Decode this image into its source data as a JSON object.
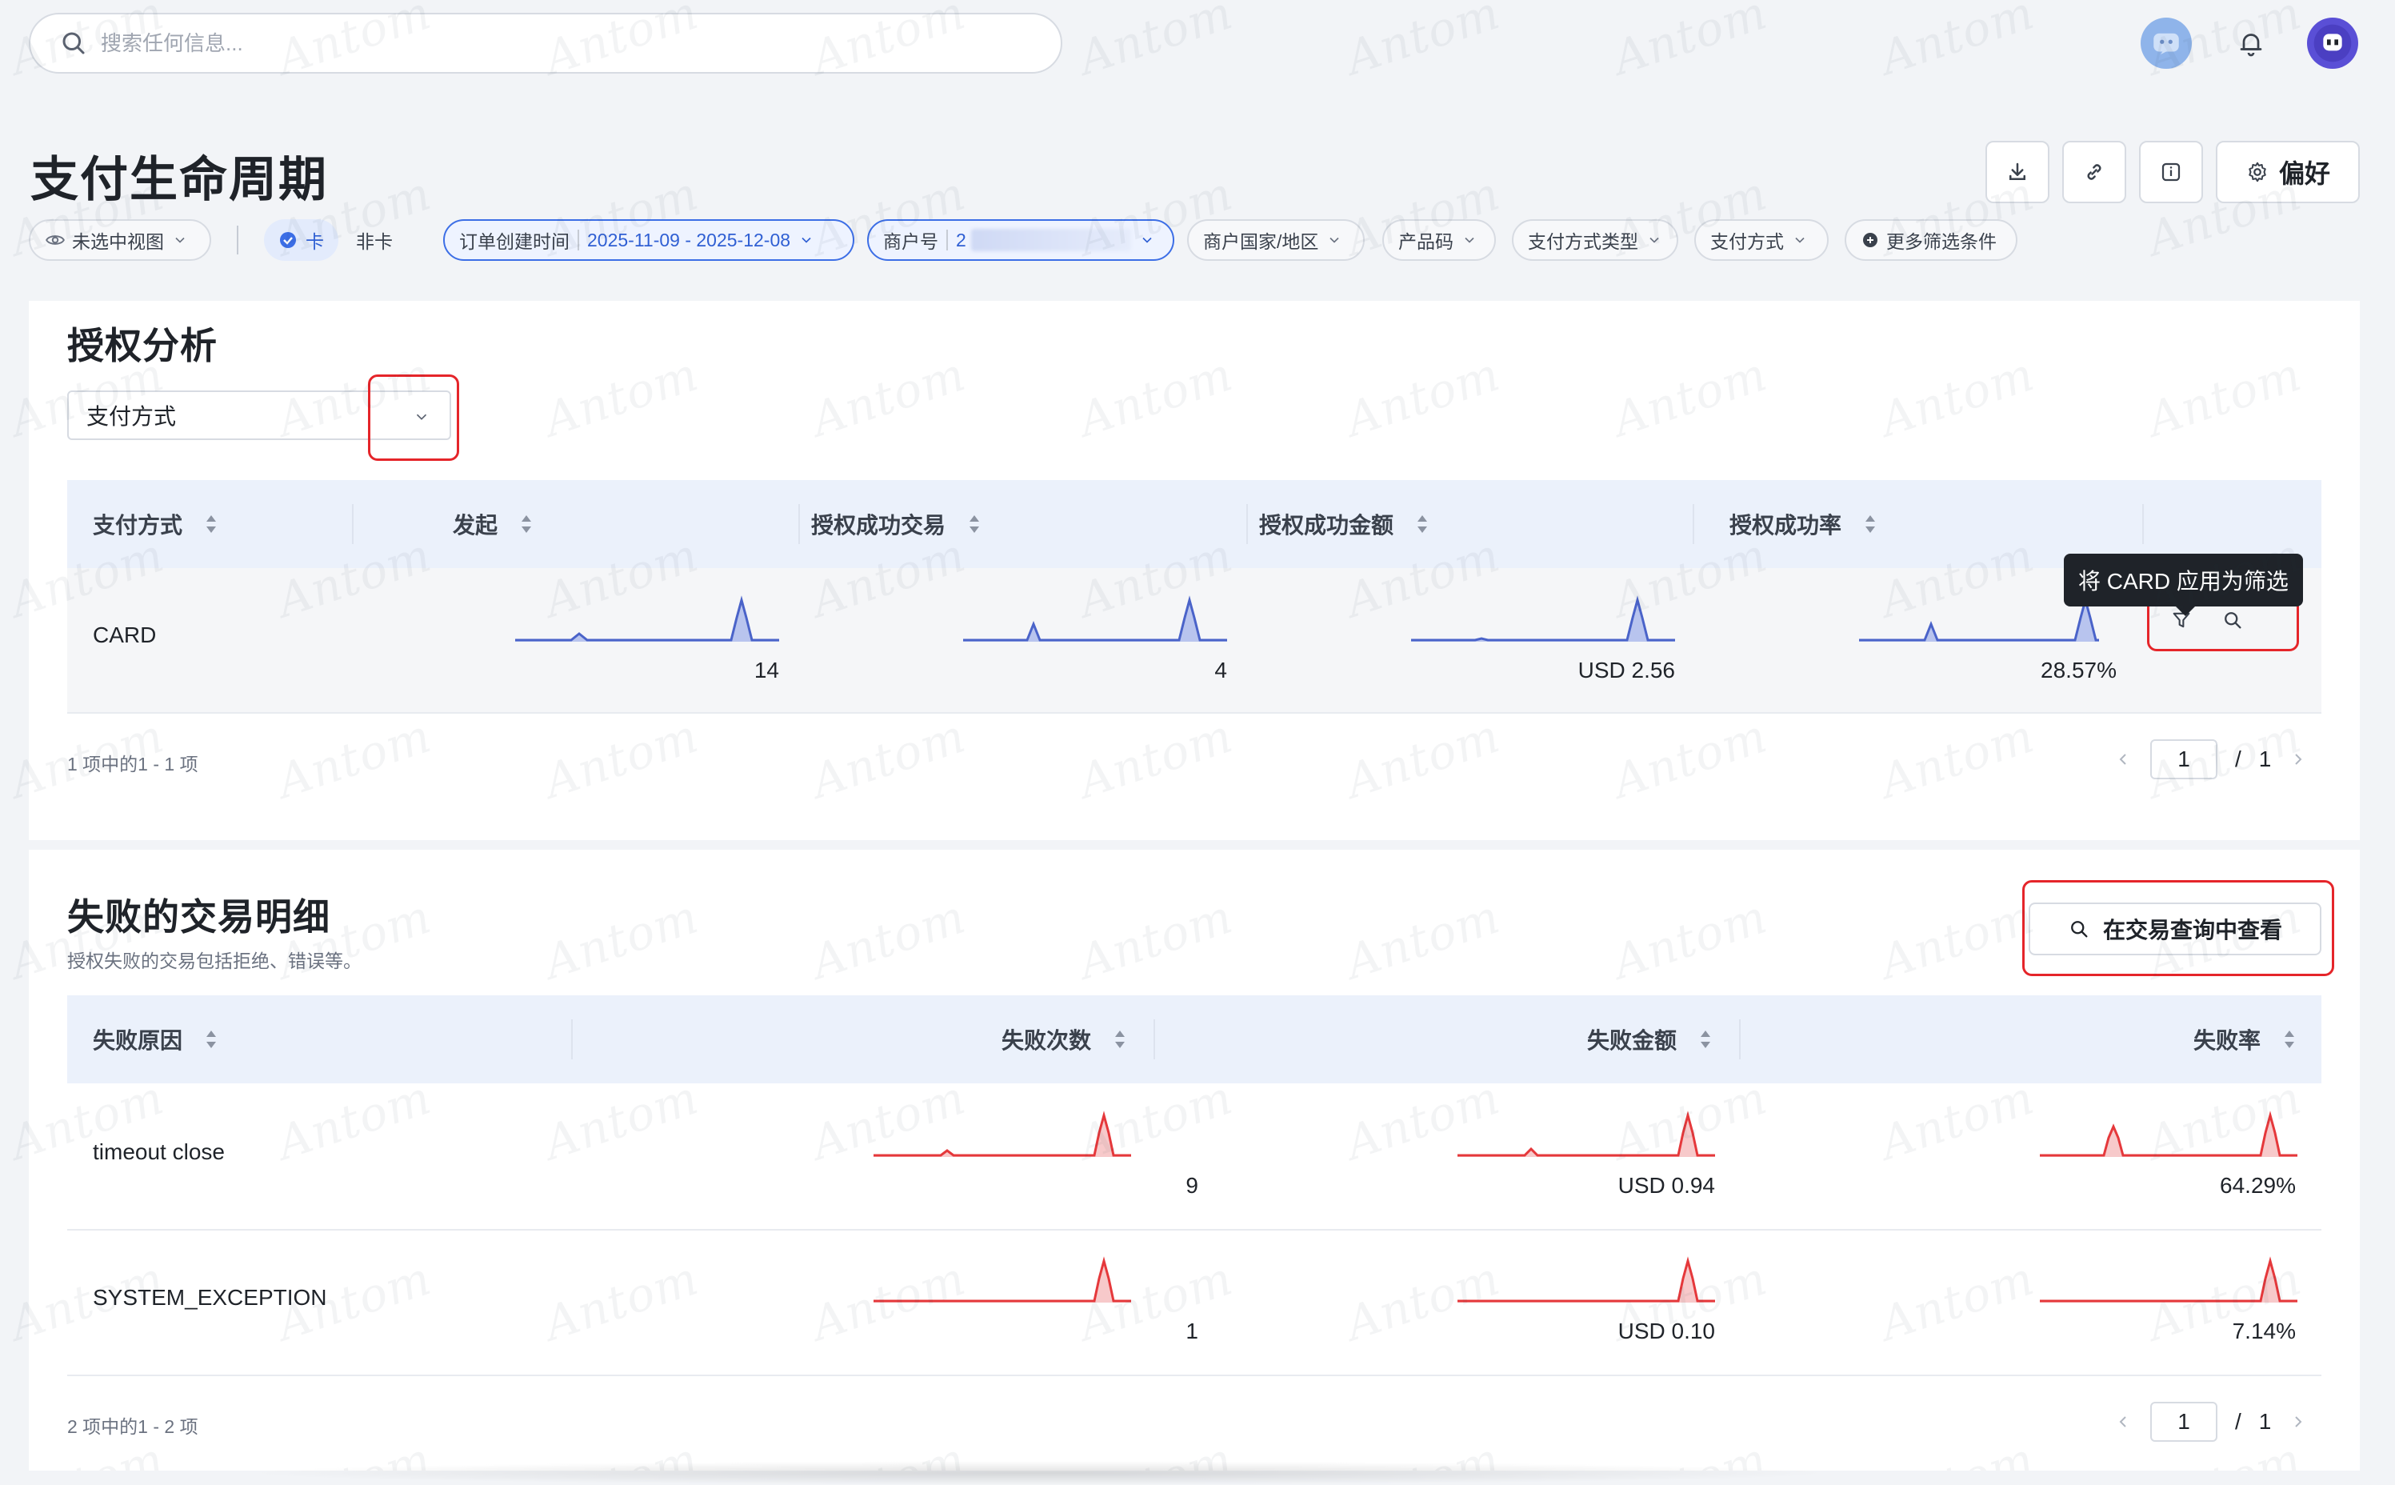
{
  "search": {
    "placeholder": "搜索任何信息..."
  },
  "header": {
    "title": "支付生命周期",
    "toolbar": {
      "preferences_label": "偏好"
    }
  },
  "filters": {
    "view": "未选中视图",
    "card_toggle": {
      "card": "卡",
      "non_card": "非卡"
    },
    "order_time": {
      "label": "订单创建时间",
      "value": "2025-11-09 - 2025-12-08"
    },
    "merchant": {
      "label": "商户号",
      "value": "2"
    },
    "country": "商户国家/地区",
    "product_code": "产品码",
    "payment_method_type": "支付方式类型",
    "payment_method": "支付方式",
    "more": "更多筛选条件"
  },
  "auth": {
    "title": "授权分析",
    "select_value": "支付方式",
    "columns": [
      "支付方式",
      "发起",
      "授权成功交易",
      "授权成功金额",
      "授权成功率"
    ],
    "rows": [
      {
        "method": "CARD",
        "initiated": "14",
        "success_count": "4",
        "success_amount": "USD 2.56",
        "success_rate": "28.57%"
      }
    ],
    "tooltip": "将 CARD 应用为筛选",
    "pager": {
      "summary": "1 项中的1 - 1 项",
      "page": "1",
      "sep": "/",
      "total": "1"
    }
  },
  "failed": {
    "title": "失败的交易明细",
    "subtitle": "授权失败的交易包括拒绝、错误等。",
    "view_button": "在交易查询中查看",
    "columns": [
      "失败原因",
      "失败次数",
      "失败金额",
      "失败率"
    ],
    "rows": [
      {
        "reason": "timeout close",
        "count": "9",
        "amount": "USD 0.94",
        "rate": "64.29%"
      },
      {
        "reason": "SYSTEM_EXCEPTION",
        "count": "1",
        "amount": "USD 0.10",
        "rate": "7.14%"
      }
    ],
    "pager": {
      "summary": "2 项中的1 - 2 项",
      "page": "1",
      "sep": "/",
      "total": "1"
    }
  },
  "watermark": "Antom",
  "colors": {
    "accent": "#3c6ee6",
    "sparkline_blue": "#4a63c9",
    "sparkline_red": "#e5383b",
    "highlight_red": "#e5252a"
  }
}
